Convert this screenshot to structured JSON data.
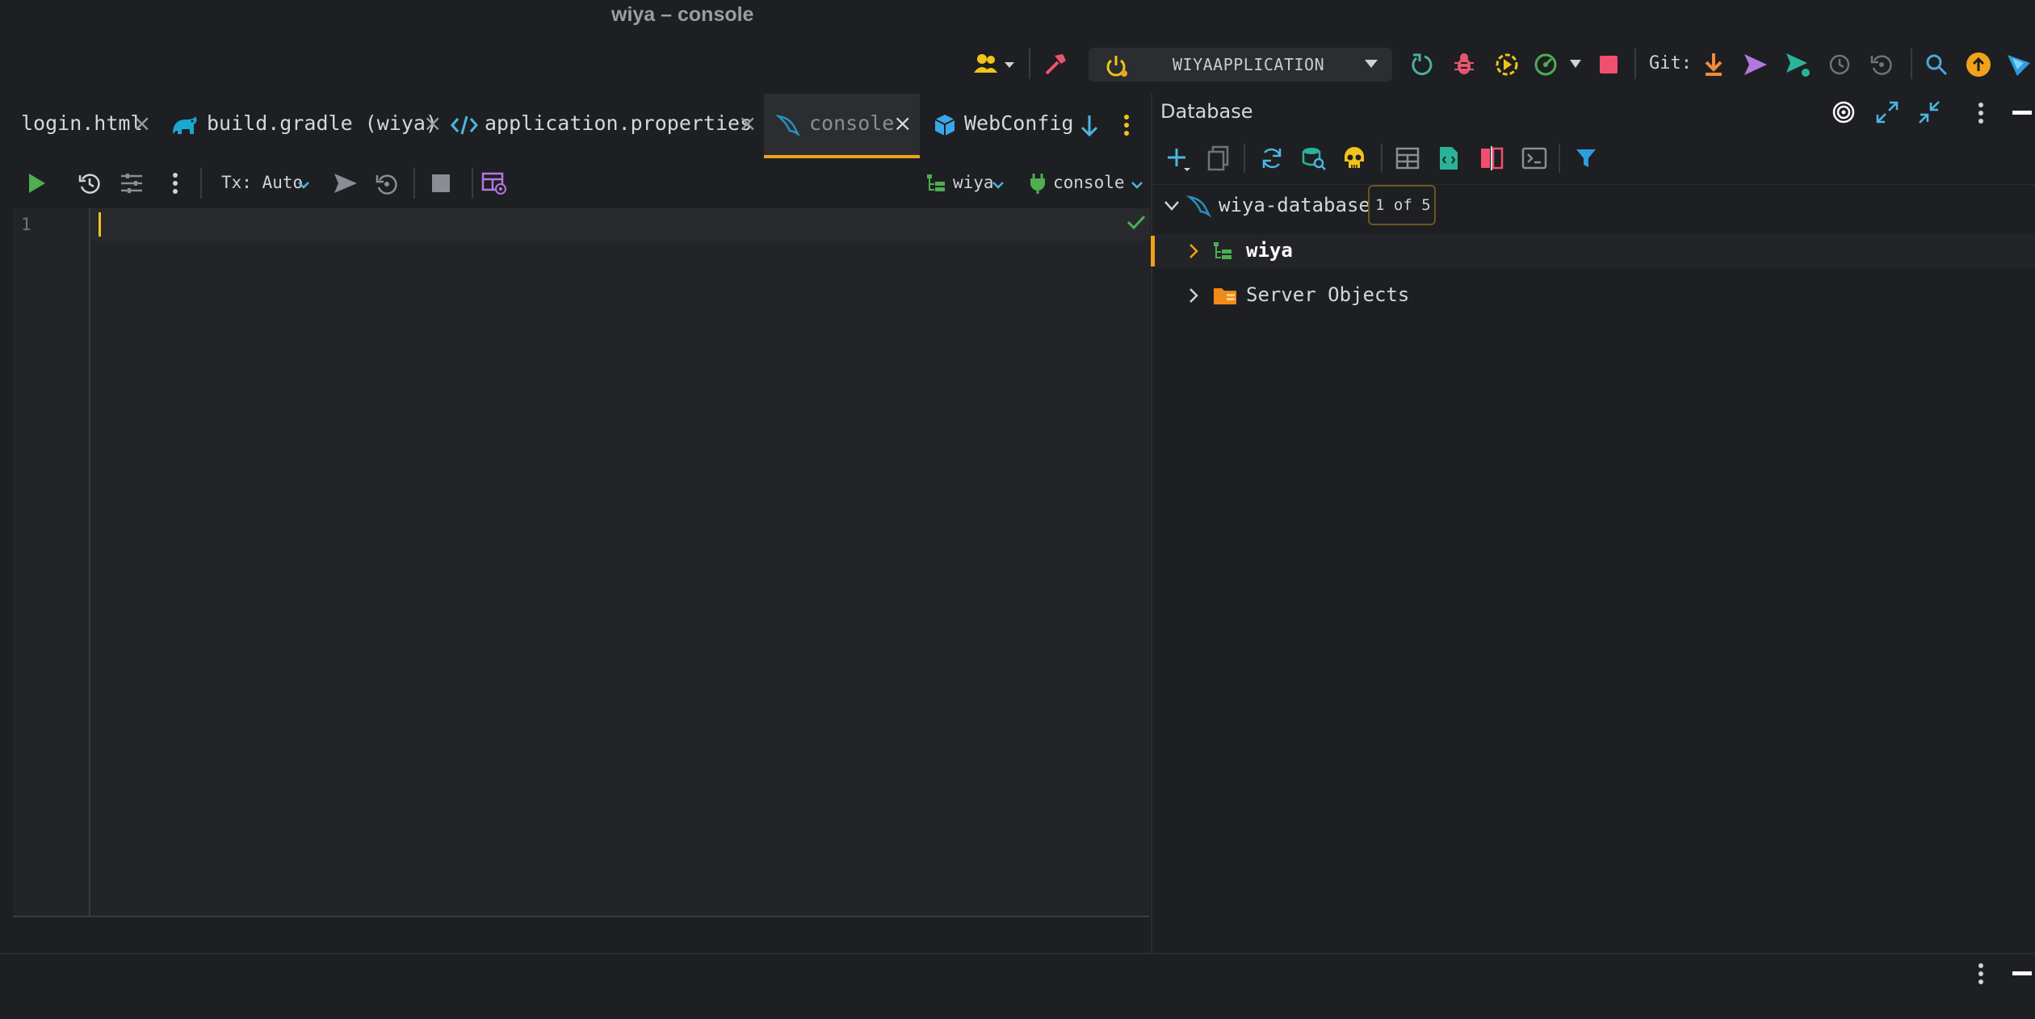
{
  "window": {
    "title": "wiya – console"
  },
  "toolbar": {
    "run_config": "WIYAAPPLICATION",
    "git_label": "Git:",
    "icons": [
      "users-icon",
      "build-hammer-icon",
      "power-icon",
      "rerun-icon",
      "debug-icon",
      "run-coverage-icon",
      "profiler-icon",
      "stop-icon",
      "git-update-icon",
      "git-push-icon",
      "git-commit-push-icon",
      "history-icon",
      "rollback-icon",
      "search-icon",
      "update-available-icon",
      "jetbrains-ai-icon"
    ],
    "colors": {
      "stop": "#f0506e",
      "debug": "#e8566e",
      "rerun": "#4caf9e",
      "accent_orange": "#f0a31a"
    }
  },
  "tabs": [
    {
      "label": "login.html",
      "icon": "html-icon"
    },
    {
      "label": "build.gradle (wiya)",
      "icon": "gradle-elephant-icon"
    },
    {
      "label": "application.properties",
      "icon": "code-icon"
    },
    {
      "label": "console",
      "icon": "mysql-dolphin-icon",
      "active": true
    },
    {
      "label": "WebConfig.j",
      "icon": "java-class-icon"
    }
  ],
  "console_toolbar": {
    "tx_mode": "Tx: Auto",
    "schema": "wiya",
    "session": "console"
  },
  "editor": {
    "line_numbers": [
      "1"
    ],
    "content": ""
  },
  "database": {
    "title": "Database",
    "tree": {
      "root": {
        "label": "wiya-database",
        "badge": "1 of 5"
      },
      "children": [
        {
          "label": "wiya",
          "selected": true
        },
        {
          "label": "Server Objects"
        }
      ]
    }
  }
}
